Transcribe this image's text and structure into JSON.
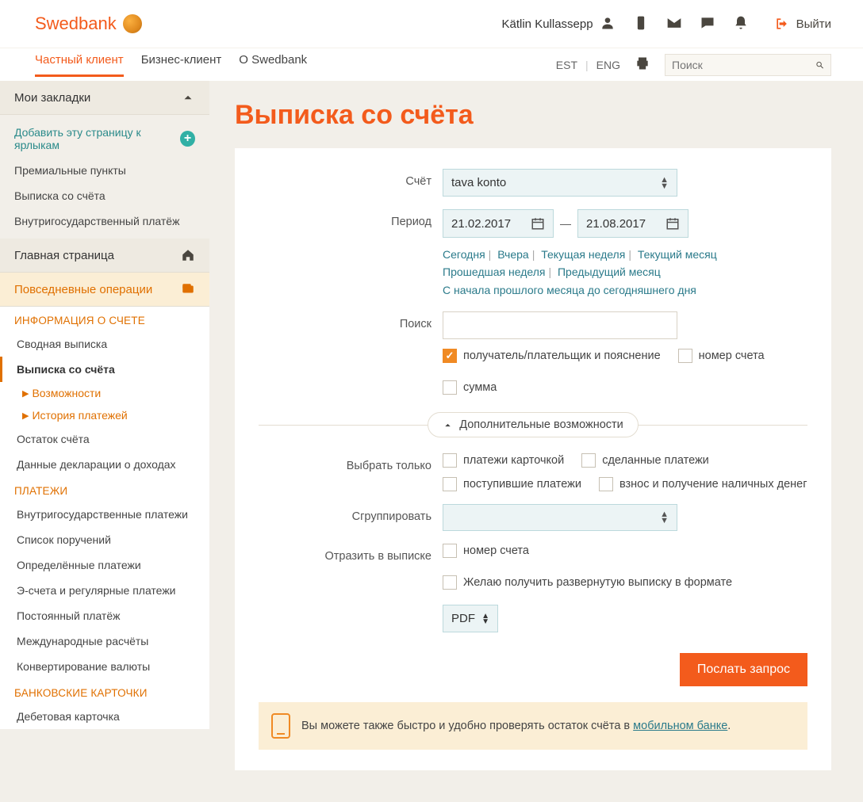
{
  "header": {
    "brand": "Swedbank",
    "user_name": "Kätlin Kullassepp",
    "logout": "Выйти",
    "nav": {
      "private": "Частный клиент",
      "business": "Бизнес-клиент",
      "about": "О Swedbank"
    },
    "lang": {
      "est": "EST",
      "eng": "ENG"
    },
    "search_placeholder": "Поиск"
  },
  "sidebar": {
    "bookmarks_title": "Мои закладки",
    "add_bookmark": "Добавить эту страницу к ярлыкам",
    "bookmarks": [
      "Премиальные пункты",
      "Выписка со счёта",
      "Внутригосударственный платёж"
    ],
    "home": "Главная страница",
    "daily_ops": "Повседневные операции",
    "group_account": "ИНФОРМАЦИЯ О СЧЕТЕ",
    "account_items": {
      "summary": "Сводная выписка",
      "statement": "Выписка со счёта",
      "sub1": "Возможности",
      "sub2": "История платежей",
      "balance": "Остаток счёта",
      "tax": "Данные декларации о доходах"
    },
    "group_payments": "ПЛАТЕЖИ",
    "payments_items": [
      "Внутригосударственные платежи",
      "Список поручений",
      "Определённые платежи",
      "Э-счета и регулярные платежи",
      "Постоянный платёж",
      "Международные расчёты",
      "Конвертирование валюты"
    ],
    "group_cards": "БАНКОВСКИЕ КАРТОЧКИ",
    "cards_items": [
      "Дебетовая карточка"
    ]
  },
  "page": {
    "title": "Выписка со счёта",
    "labels": {
      "account": "Счёт",
      "period": "Период",
      "search": "Поиск",
      "select_only": "Выбрать только",
      "group_by": "Сгруппировать",
      "reflect": "Отразить в выписке"
    },
    "account_value": "tava konto",
    "date_from": "21.02.2017",
    "date_to": "21.08.2017",
    "period_links": {
      "today": "Сегодня",
      "yesterday": "Вчера",
      "this_week": "Текущая неделя",
      "this_month": "Текущий месяц",
      "last_week": "Прошедшая неделя",
      "last_month": "Предыдущий месяц",
      "from_last_month": "С начала прошлого месяца до сегодняшнего дня"
    },
    "chk": {
      "payer_expl": "получатель/плательщик и пояснение",
      "account_no": "номер счета",
      "amount": "сумма",
      "card_payments": "платежи карточкой",
      "made_payments": "сделанные платежи",
      "received": "поступившие платежи",
      "cash": "взнос и получение наличных денег",
      "reflect_account": "номер счета",
      "extended_format": "Желаю получить развернутую выписку в формате"
    },
    "expand_label": "Дополнительные возможности",
    "format_value": "PDF",
    "submit": "Послать запрос",
    "notice_text": "Вы можете также быстро и удобно проверять остаток счёта в ",
    "notice_link": "мобильном банке"
  }
}
